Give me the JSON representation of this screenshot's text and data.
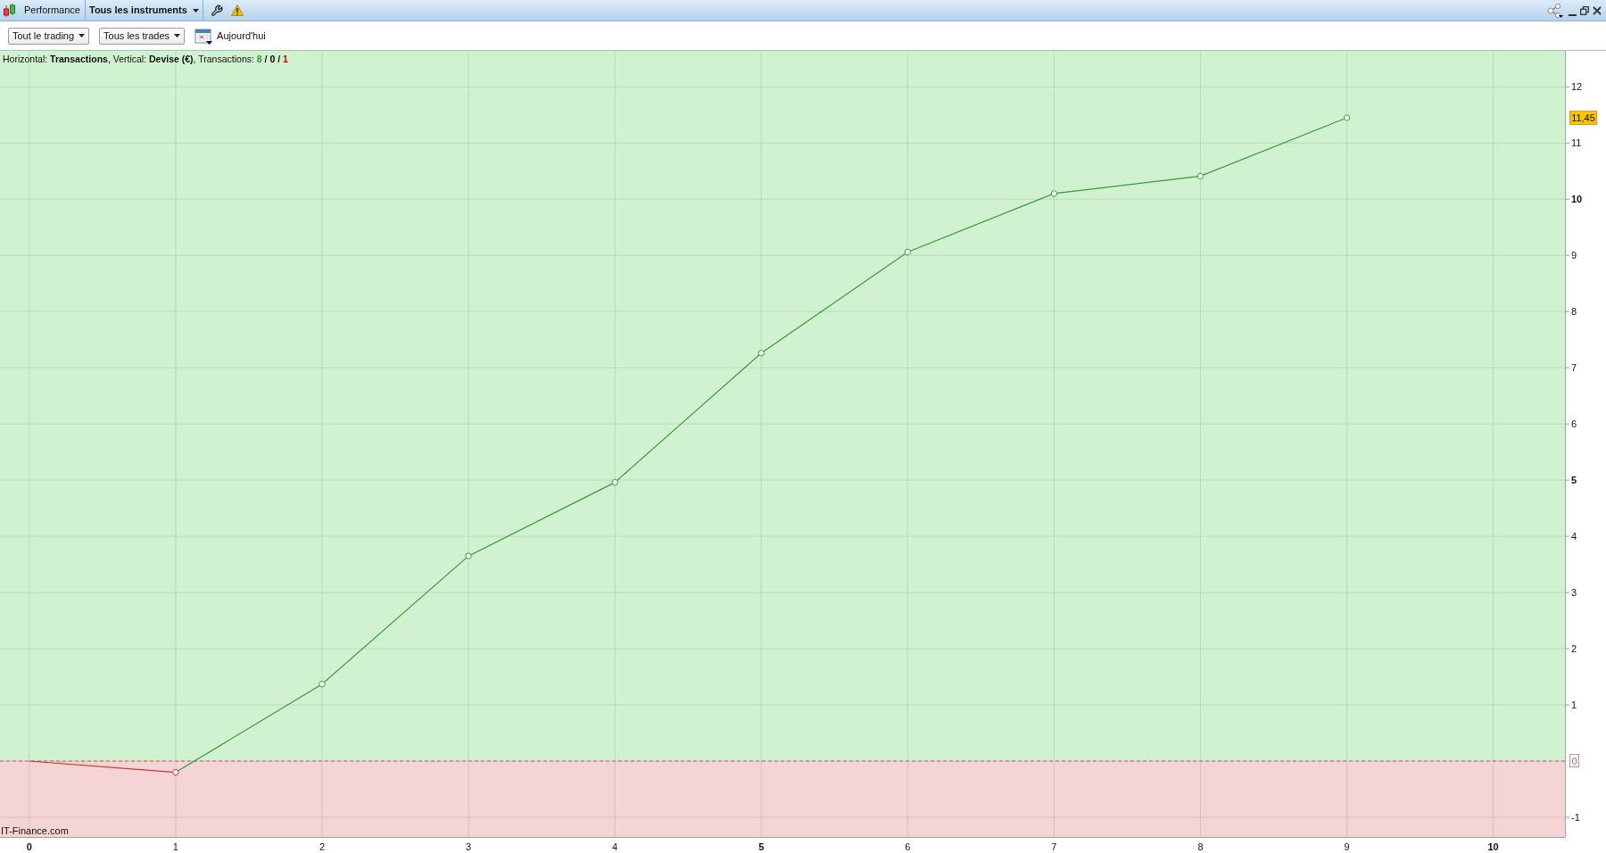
{
  "title_bar": {
    "title": "Performance",
    "instrument_selector": "Tous les instruments"
  },
  "toolbar": {
    "dropdowns": [
      "Tout le trading",
      "Tous les trades"
    ],
    "date_button": "Aujourd'hui"
  },
  "chart": {
    "caption": "Horizontal: **Transactions**, Vertical: **Devise (€)**, Transactions: ",
    "counts": [
      {
        "text": "8",
        "color": "#2e9e2e"
      },
      {
        "text": "0",
        "color": "#000000"
      },
      {
        "text": "1",
        "color": "#cc0000"
      }
    ],
    "count_separator": "/",
    "credit": "IT-Finance.com",
    "chart_data": {
      "type": "line",
      "xlim": [
        -0.2,
        10.49
      ],
      "ylim": [
        -1.35,
        12.64
      ],
      "xticks": [
        0,
        1,
        2,
        3,
        4,
        5,
        6,
        7,
        8,
        9,
        10
      ],
      "yticks": [
        -1,
        0,
        1,
        2,
        3,
        4,
        5,
        6,
        7,
        8,
        9,
        10,
        11,
        12
      ],
      "grid": true,
      "marker": "circle",
      "series": [
        {
          "color": "#cc3333",
          "x": [
            0,
            1
          ],
          "values": [
            0,
            -0.2
          ]
        },
        {
          "color": "#3a9a3a",
          "x": [
            1,
            2,
            3,
            4,
            5,
            6,
            7,
            8,
            9
          ],
          "values": [
            -0.2,
            1.37,
            3.65,
            4.96,
            7.26,
            9.06,
            10.1,
            10.41,
            11.45
          ]
        }
      ],
      "bands": [
        {
          "axis": "y",
          "from": 0,
          "to": 12.64,
          "color": "#d0f2d0"
        },
        {
          "axis": "y",
          "from": -1.35,
          "to": 0,
          "color": "#f4d4d4"
        }
      ],
      "ref_lines": [
        {
          "axis": "y",
          "value": 0,
          "color": "#d05a5a",
          "line_style": "dashed"
        }
      ],
      "annotations": [
        "11,45"
      ]
    }
  }
}
